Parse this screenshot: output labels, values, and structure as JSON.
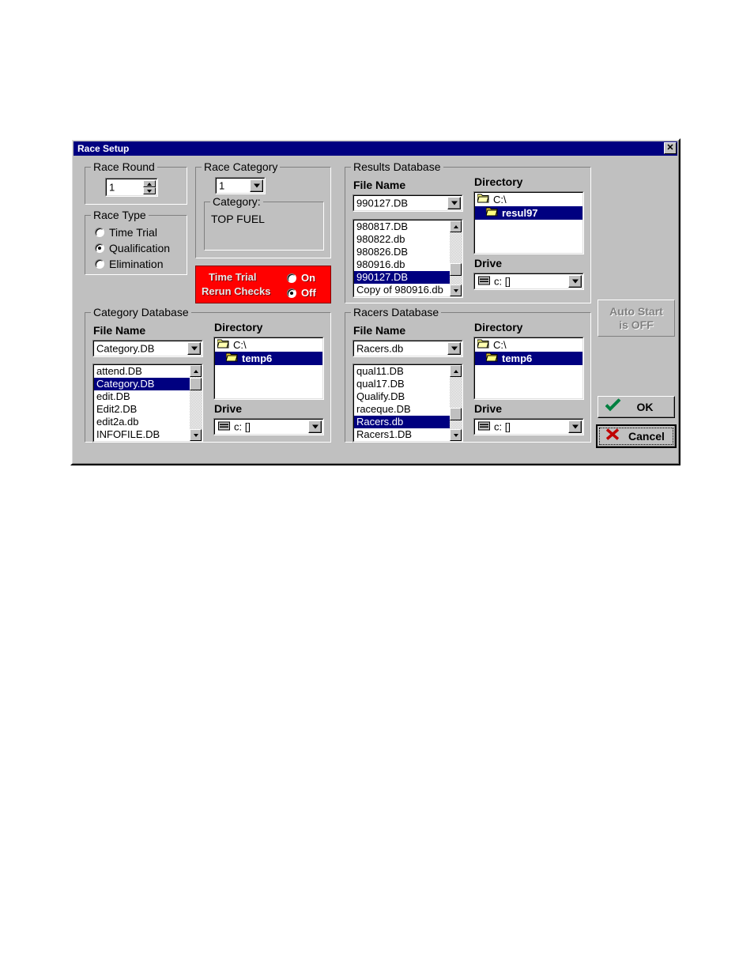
{
  "dialog": {
    "title": "Race Setup",
    "close_label": "✕"
  },
  "race_round": {
    "legend": "Race Round",
    "value": "1"
  },
  "race_type": {
    "legend": "Race Type",
    "options": [
      {
        "label": "Time Trial",
        "selected": false
      },
      {
        "label": "Qualification",
        "selected": true
      },
      {
        "label": "Elimination",
        "selected": false
      }
    ]
  },
  "race_category": {
    "legend": "Race Category",
    "value": "1",
    "category_legend": "Category:",
    "category_value": "TOP FUEL"
  },
  "rerun_checks": {
    "line1": "Time Trial",
    "line2": "Rerun Checks",
    "on_label": "On",
    "off_label": "Off",
    "on_selected": false,
    "off_selected": true,
    "bg_color": "#ff0000"
  },
  "results_db": {
    "legend": "Results Database",
    "file_name_label": "File Name",
    "file_name_value": "990127.DB",
    "files": [
      {
        "name": "980817.DB",
        "selected": false
      },
      {
        "name": "980822.db",
        "selected": false
      },
      {
        "name": "980826.DB",
        "selected": false
      },
      {
        "name": "980916.db",
        "selected": false
      },
      {
        "name": "990127.DB",
        "selected": true
      },
      {
        "name": "Copy of 980916.db",
        "selected": false
      }
    ],
    "directory_label": "Directory",
    "directories": [
      {
        "name": "C:\\",
        "selected": false
      },
      {
        "name": "resul97",
        "selected": true
      }
    ],
    "drive_label": "Drive",
    "drive_value": "c: []"
  },
  "category_db": {
    "legend": "Category Database",
    "file_name_label": "File Name",
    "file_name_value": "Category.DB",
    "files": [
      {
        "name": "attend.DB",
        "selected": false
      },
      {
        "name": "Category.DB",
        "selected": true
      },
      {
        "name": "edit.DB",
        "selected": false
      },
      {
        "name": "Edit2.DB",
        "selected": false
      },
      {
        "name": "edit2a.db",
        "selected": false
      },
      {
        "name": "INFOFILE.DB",
        "selected": false
      }
    ],
    "directory_label": "Directory",
    "directories": [
      {
        "name": "C:\\",
        "selected": false
      },
      {
        "name": "temp6",
        "selected": true
      }
    ],
    "drive_label": "Drive",
    "drive_value": "c: []"
  },
  "racers_db": {
    "legend": "Racers Database",
    "file_name_label": "File Name",
    "file_name_value": "Racers.db",
    "files": [
      {
        "name": "qual11.DB",
        "selected": false
      },
      {
        "name": "qual17.DB",
        "selected": false
      },
      {
        "name": "Qualify.DB",
        "selected": false
      },
      {
        "name": "raceque.DB",
        "selected": false
      },
      {
        "name": "Racers.db",
        "selected": true
      },
      {
        "name": "Racers1.DB",
        "selected": false
      }
    ],
    "directory_label": "Directory",
    "directories": [
      {
        "name": "C:\\",
        "selected": false
      },
      {
        "name": "temp6",
        "selected": true
      }
    ],
    "drive_label": "Drive",
    "drive_value": "c: []"
  },
  "actions": {
    "auto_start_line1": "Auto Start",
    "auto_start_line2": "is OFF",
    "ok_label": "OK",
    "cancel_label": "Cancel"
  }
}
